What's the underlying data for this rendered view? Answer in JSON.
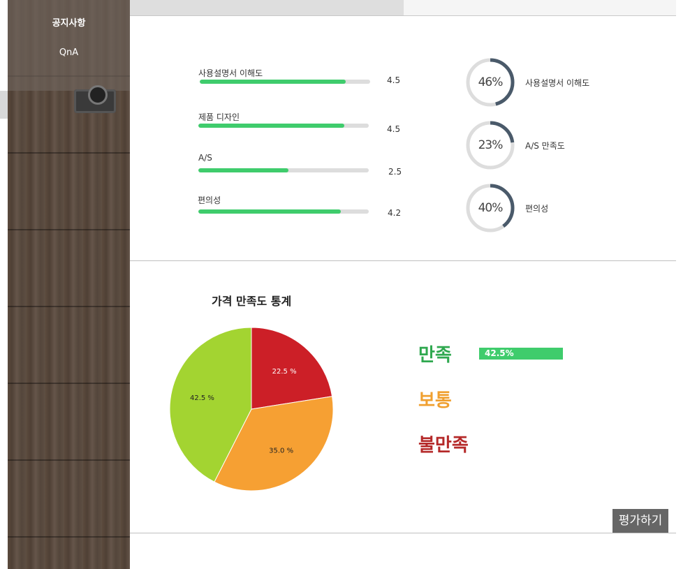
{
  "sidebar": {
    "items": [
      {
        "label": "공지사항"
      },
      {
        "label": "QnA"
      }
    ]
  },
  "ratings": [
    {
      "label": "사용설명서 이해도",
      "value": "4.5",
      "fill_fraction": 0.855
    },
    {
      "label": "제품 디자인",
      "value": "4.5",
      "fill_fraction": 0.855
    },
    {
      "label": "A/S",
      "value": "2.5",
      "fill_fraction": 0.529
    },
    {
      "label": "편의성",
      "value": "4.2",
      "fill_fraction": 0.836
    }
  ],
  "circles": [
    {
      "percent_text": "46%",
      "percent": 46,
      "label": "사용설명서 이해도"
    },
    {
      "percent_text": "23%",
      "percent": 23,
      "label": "A/S 만족도"
    },
    {
      "percent_text": "40%",
      "percent": 40,
      "label": "편의성"
    }
  ],
  "price_chart": {
    "title": "가격 만족도 통계",
    "legend": [
      {
        "label": "만족",
        "color": "#2fa84f"
      },
      {
        "label": "보통",
        "color": "#f0a030"
      },
      {
        "label": "불만족",
        "color": "#b52a2a"
      }
    ],
    "selected_bar_label": "42.5%",
    "selected_bar_color": "#3fcc6c"
  },
  "chart_data": {
    "type": "pie",
    "title": "가격 만족도 통계",
    "slices": [
      {
        "label": "22.5 %",
        "value": 22.5,
        "color": "#cc1f27"
      },
      {
        "label": "35.0 %",
        "value": 35.0,
        "color": "#f6a033"
      },
      {
        "label": "42.5 %",
        "value": 42.5,
        "color": "#a3d431"
      }
    ]
  },
  "actions": {
    "evaluate_label": "평가하기"
  },
  "colors": {
    "rating_fill": "#3fcc6c",
    "circle_arc": "#4a5a6a",
    "circle_track": "#dddddd"
  }
}
